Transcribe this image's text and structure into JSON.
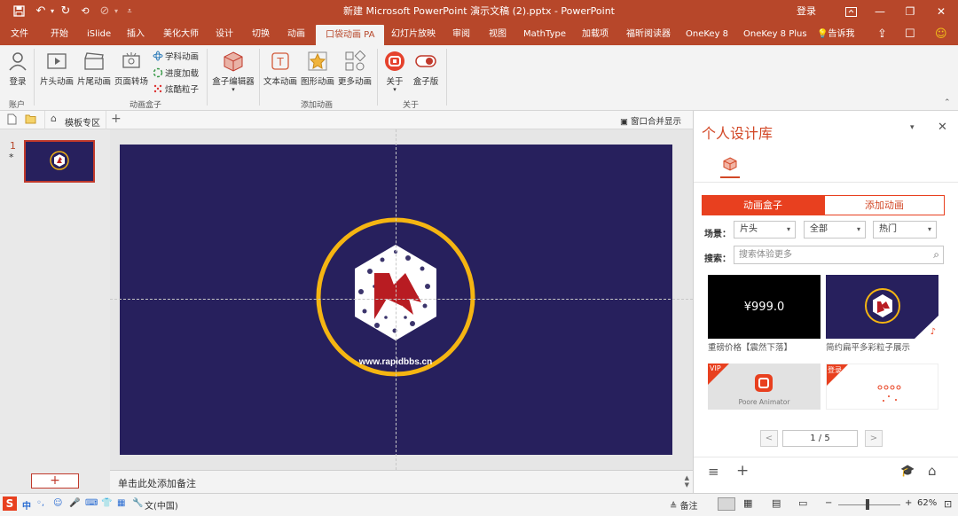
{
  "colors": {
    "accent": "#b7472a",
    "slide_bg": "#27205d",
    "ring": "#f5b512",
    "logo_red": "#b81c22",
    "panel_accent": "#d24726"
  },
  "quick_access": {
    "save_icon": "save-icon",
    "undo_icon": "undo-icon",
    "redo_icon": "redo-icon",
    "customize_icon": "customize-icon"
  },
  "window": {
    "title": "新建 Microsoft PowerPoint 演示文稿 (2).pptx  -  PowerPoint",
    "login": "登录",
    "minimize": "—",
    "restore": "❐",
    "close": "✕"
  },
  "tabs": [
    "文件",
    "开始",
    "iSlide",
    "插入",
    "美化大师",
    "设计",
    "切换",
    "动画",
    "口袋动画 PA",
    "幻灯片放映",
    "审阅",
    "视图",
    "MathType",
    "加载项",
    "福昕阅读器",
    "OneKey 8",
    "OneKey 8 Plus"
  ],
  "tell_me": "告诉我",
  "ribbon": {
    "account": {
      "login": "登录",
      "group": "账户"
    },
    "anim_box": {
      "intro": "片头动画",
      "outro": "片尾动画",
      "page_transition": "页面转场",
      "subject_anim": "学科动画",
      "progress_load": "进度加载",
      "cool_particles": "炫酷粒子",
      "group": "动画盒子"
    },
    "box_editor": "盒子编辑器",
    "add_anim": {
      "text": "文本动画",
      "shape": "图形动画",
      "more": "更多动画",
      "group": "添加动画"
    },
    "about": {
      "about": "关于",
      "box_edition": "盒子版",
      "group": "关于"
    }
  },
  "file_strip": {
    "template": "模板专区",
    "merge": "窗口合并显示"
  },
  "thumbnails": {
    "number": "1",
    "star": "*",
    "add": "+"
  },
  "slide": {
    "url": "www.rapidbbs.cn"
  },
  "notes": {
    "placeholder": "单击此处添加备注"
  },
  "panel": {
    "title": "个人设计库",
    "seg_box": "动画盒子",
    "seg_add": "添加动画",
    "scene_label": "场景：",
    "scene": "片头",
    "all": "全部",
    "hot": "热门",
    "search_label": "搜索：",
    "search_placeholder": "搜索体验更多",
    "cards": [
      {
        "caption": "重磅价格【震然下落】",
        "text": "¥999.0"
      },
      {
        "caption": "简约扁平多彩粒子展示"
      },
      {
        "badge": "VIP",
        "text": "Poore Animator"
      },
      {
        "badge": "登录"
      }
    ],
    "page": "1 / 5",
    "prev": "<",
    "next": ">"
  },
  "status": {
    "ime": "中",
    "lang": "文(中国)",
    "notes": "备注",
    "zoom": "62%"
  }
}
